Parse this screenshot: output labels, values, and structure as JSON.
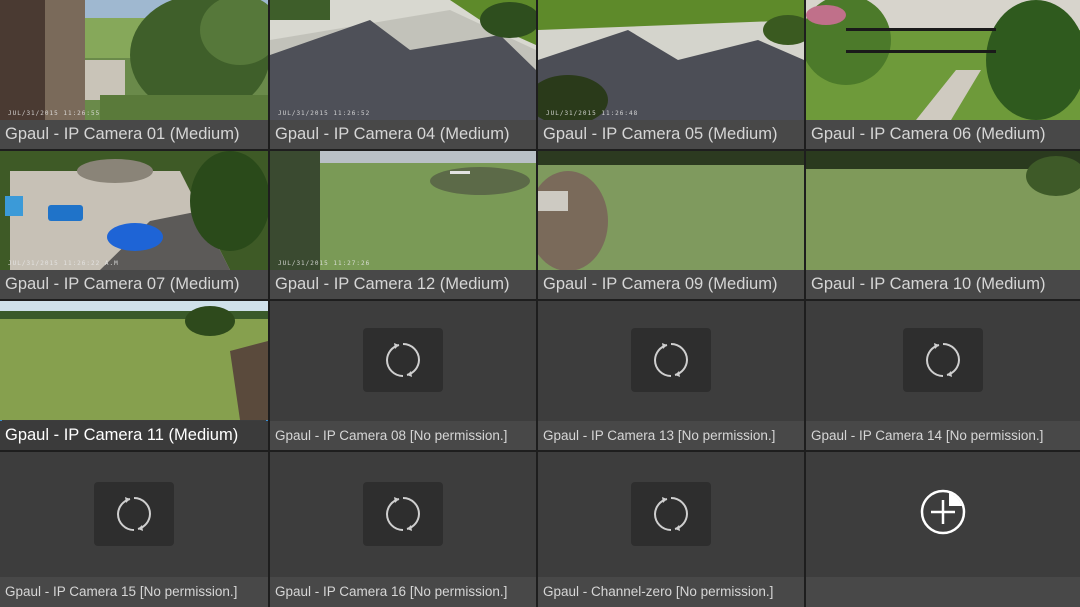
{
  "tiles": [
    {
      "label": "Gpaul - IP Camera 01 (Medium)",
      "stamp": "JUL/31/2015 11:26:55"
    },
    {
      "label": "Gpaul - IP Camera 04 (Medium)",
      "stamp": "JUL/31/2015 11:26:52"
    },
    {
      "label": "Gpaul - IP Camera 05 (Medium)",
      "stamp": "JUL/31/2015 11:26:48"
    },
    {
      "label": "Gpaul - IP Camera 06 (Medium)",
      "stamp": ""
    },
    {
      "label": "Gpaul - IP Camera 07 (Medium)",
      "stamp": "JUL/31/2015 11:26:22 A.M"
    },
    {
      "label": "Gpaul - IP Camera 12 (Medium)",
      "stamp": "JUL/31/2015 11:27:26"
    },
    {
      "label": "Gpaul - IP Camera 09 (Medium)",
      "stamp": ""
    },
    {
      "label": "Gpaul - IP Camera 10 (Medium)",
      "stamp": ""
    },
    {
      "label": "Gpaul - IP Camera 11 (Medium)",
      "stamp": ""
    },
    {
      "label": "Gpaul - IP Camera 08 [No permission.]"
    },
    {
      "label": "Gpaul - IP Camera 13 [No permission.]"
    },
    {
      "label": "Gpaul - IP Camera 14 [No permission.]"
    },
    {
      "label": "Gpaul - IP Camera 15 [No permission.]"
    },
    {
      "label": "Gpaul - IP Camera 16 [No permission.]"
    },
    {
      "label": "Gpaul - Channel-zero [No permission.]"
    },
    {
      "label": ""
    }
  ],
  "icons": {
    "loading": "refresh-icon",
    "add": "add-camera-icon"
  },
  "colors": {
    "selection": "#3a8fd6",
    "tile_bg": "#3d3d3d",
    "label_bg": "#484848"
  }
}
